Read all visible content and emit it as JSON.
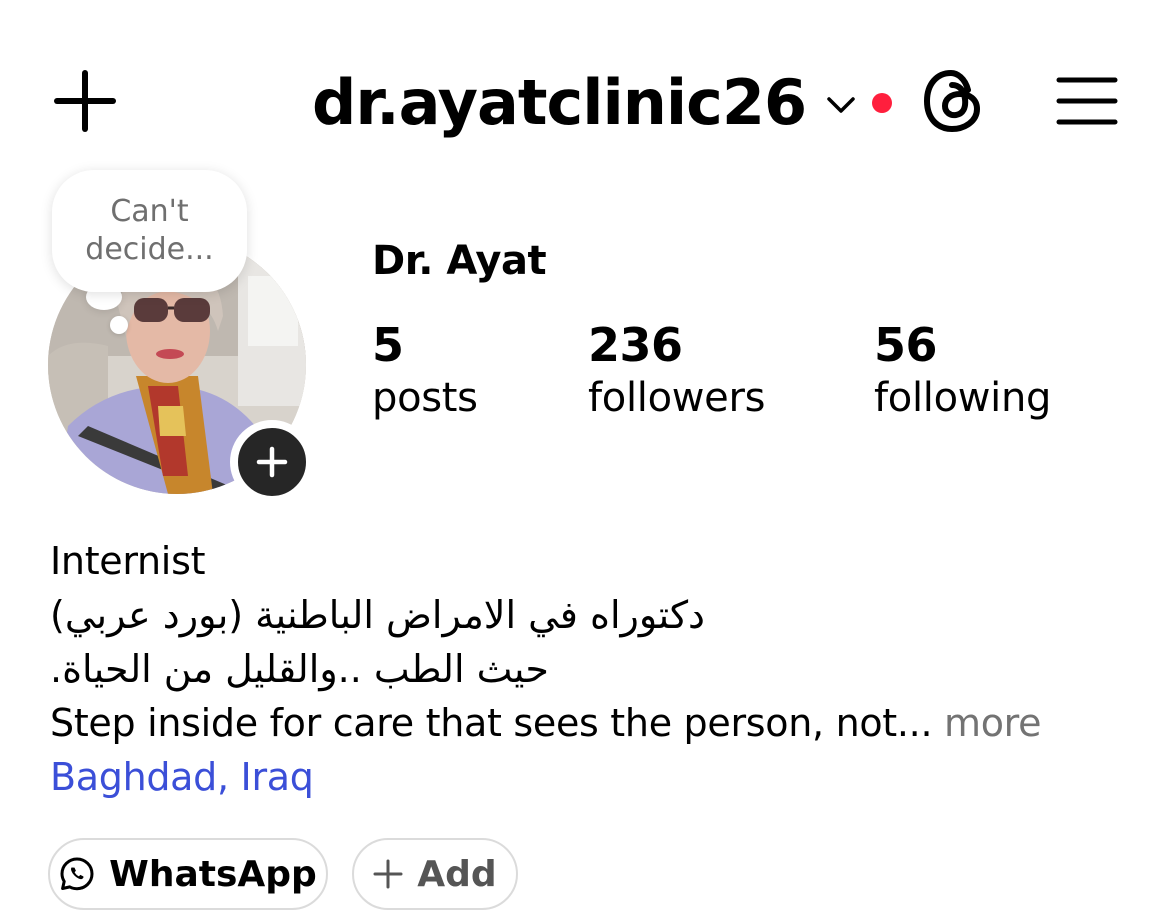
{
  "header": {
    "username": "dr.ayatclinic26",
    "icons": {
      "create": "plus-icon",
      "switch": "chevron-down-icon",
      "threads": "threads-icon",
      "menu": "hamburger-menu-icon"
    },
    "notification_dot_color": "#ff1f3d"
  },
  "profile": {
    "note": "Can't decide...",
    "display_name": "Dr. Ayat",
    "stats": {
      "posts": {
        "value": "5",
        "label": "posts"
      },
      "followers": {
        "value": "236",
        "label": "followers"
      },
      "following": {
        "value": "56",
        "label": "following"
      }
    }
  },
  "bio": {
    "line1": "Internist",
    "line2": "دكتوراه في الامراض الباطنية (بورد عربي)",
    "line3": "حيث الطب ..والقليل من الحياة.",
    "line4": "Step inside for care that sees the person, not...",
    "more": "more",
    "location": "Baghdad, Iraq",
    "location_color": "#3b4fd8"
  },
  "buttons": {
    "whatsapp": "WhatsApp",
    "add": "Add"
  }
}
